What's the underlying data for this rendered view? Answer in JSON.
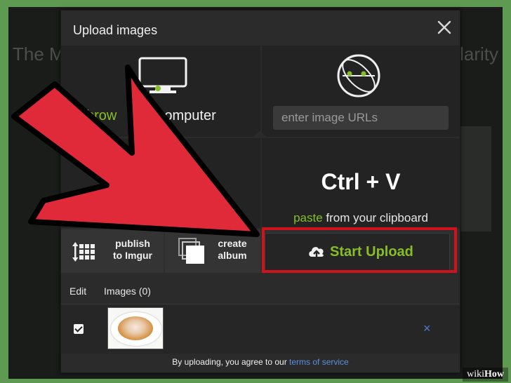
{
  "background": {
    "page_title_left": "The M",
    "page_title_right": "larity"
  },
  "modal": {
    "title": "Upload images",
    "close_icon": "close-icon"
  },
  "panels": {
    "computer": {
      "icon": "monitor-icon",
      "label_accent": "brow",
      "label_rest": "computer"
    },
    "url": {
      "icon": "globe-icon",
      "placeholder": "enter image URLs"
    },
    "paste": {
      "shortcut": "Ctrl + V",
      "accent": "paste",
      "rest": "from your clipboard"
    }
  },
  "actions": {
    "publish_line1": "publish",
    "publish_line2": "to Imgur",
    "album_line1": "create",
    "album_line2": "album",
    "start_upload": "Start Upload"
  },
  "image_list": {
    "edit_label": "Edit",
    "images_label": "Images (0)",
    "remove_symbol": "×"
  },
  "footer": {
    "text": "By uploading, you agree to our",
    "link": "terms of service"
  },
  "watermark": {
    "wiki": "wiki",
    "how": "How"
  },
  "colors": {
    "accent_green": "#85bf25",
    "highlight_red": "#d0121c",
    "arrow_red": "#e02a3a",
    "link_blue": "#5b8fe0"
  }
}
